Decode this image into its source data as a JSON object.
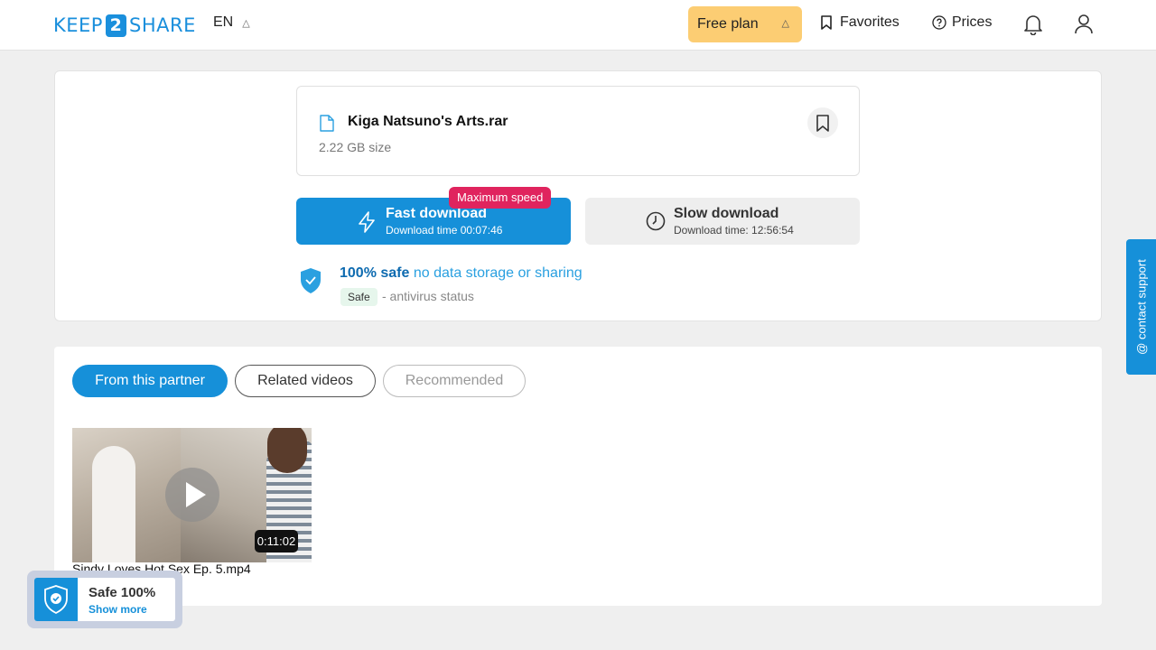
{
  "header": {
    "logo_left": "KEEP",
    "logo_mid": "2",
    "logo_right": "SHARE",
    "language": "EN",
    "plan_label": "Free plan",
    "favorites_label": "Favorites",
    "prices_label": "Prices"
  },
  "file": {
    "name": "Kiga Natsuno's Arts.rar",
    "size": "2.22 GB size"
  },
  "download": {
    "fast_title": "Fast download",
    "fast_time": "Download time 00:07:46",
    "badge": "Maximum speed",
    "slow_title": "Slow download",
    "slow_time": "Download time: 12:56:54"
  },
  "safety": {
    "bold": "100% safe",
    "normal": "no data storage or sharing",
    "tag": "Safe",
    "antivirus": "- antivirus status"
  },
  "tabs": [
    "From this partner",
    "Related videos",
    "Recommended"
  ],
  "videos": [
    {
      "title": "Sindy Loves Hot Sex Ep. 5.mp4",
      "duration": "0:11:02"
    }
  ],
  "contact_support": "@ contact support",
  "safe_widget": {
    "title": "Safe 100%",
    "link": "Show more"
  },
  "colors": {
    "accent": "#1690d9",
    "plan": "#fccd73",
    "badge": "#e0245e"
  }
}
